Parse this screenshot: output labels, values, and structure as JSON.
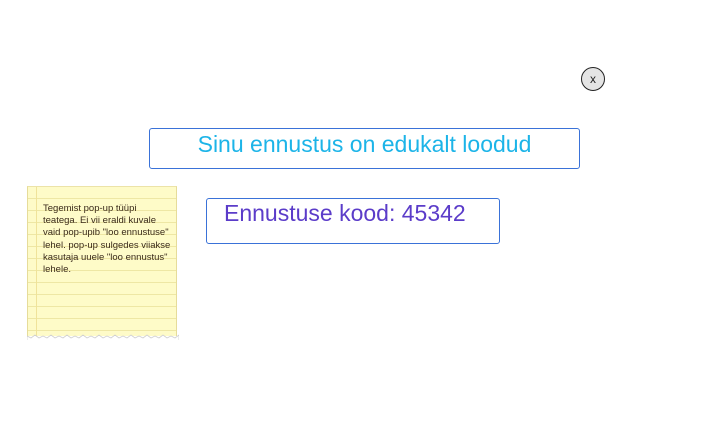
{
  "popup": {
    "close_label": "x",
    "success_message": "Sinu ennustus on edukalt loodud",
    "code_label": "Ennustuse kood:",
    "code_value": "45342"
  },
  "sticky_note": {
    "text": "Tegemist pop-up tüüpi teatega. Ei vii eraldi kuvale vaid pop-upib \"loo ennustuse\" lehel. pop-up sulgedes viiakse kasutaja uuele \"loo ennustus\" lehele."
  },
  "colors": {
    "success_text": "#1cb4e8",
    "code_text": "#5b3cc9",
    "box_border": "#3a72d8",
    "note_background": "#fefbc8"
  }
}
